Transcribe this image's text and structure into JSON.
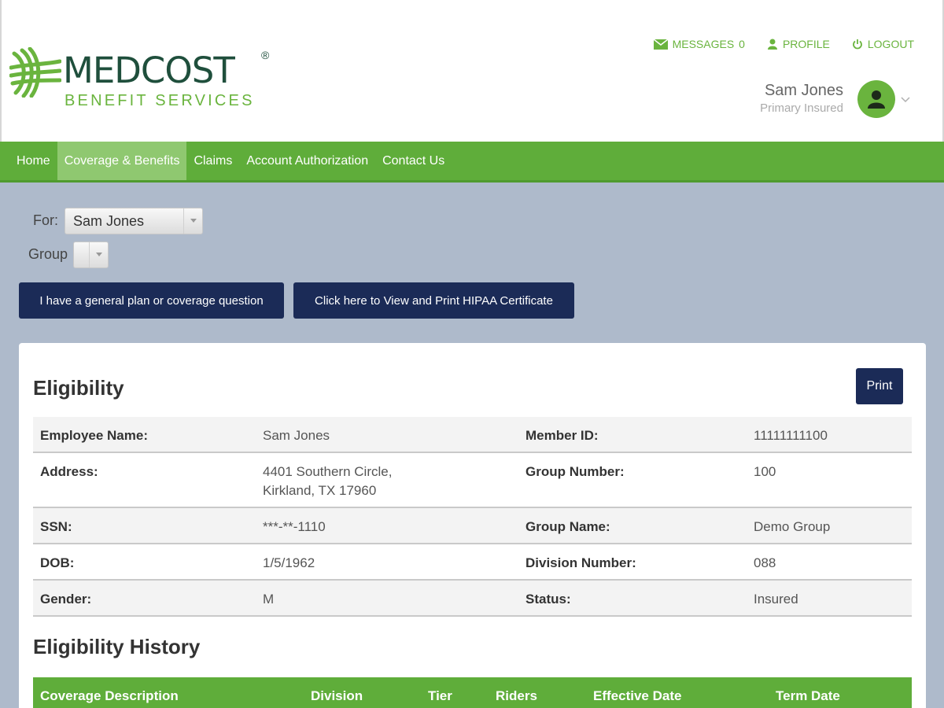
{
  "brand": {
    "name": "MEDCOST",
    "registered": "®",
    "subtitle": "BENEFIT SERVICES",
    "colors": {
      "green": "#6ab43e",
      "dark_green": "#1f4f3c",
      "navy": "#1b2b57",
      "nav_bg": "#5fad3a"
    }
  },
  "toplinks": {
    "messages_label": "MESSAGES",
    "messages_count": "0",
    "profile_label": "PROFILE",
    "logout_label": "LOGOUT",
    "icons": [
      "envelope-icon",
      "person-icon",
      "power-icon"
    ]
  },
  "user": {
    "name": "Sam Jones",
    "role": "Primary Insured"
  },
  "nav": {
    "items": [
      "Home",
      "Coverage & Benefits",
      "Claims",
      "Account Authorization",
      "Contact Us"
    ],
    "active": "Coverage & Benefits"
  },
  "filters": {
    "for_label": "For:",
    "for_value": "Sam Jones",
    "group_label": "Group",
    "group_value": ""
  },
  "actions": {
    "question_button": "I have a general plan or coverage question",
    "hipaa_button": "Click here to View and Print HIPAA Certificate"
  },
  "eligibility": {
    "title": "Eligibility",
    "print_label": "Print",
    "rows": [
      {
        "label1": "Employee Name:",
        "value1": "Sam Jones",
        "label2": "Member ID:",
        "value2": "11111111100"
      },
      {
        "label1": "Address:",
        "value1": "4401 Southern Circle,",
        "value1b": "Kirkland, TX 17960",
        "label2": "Group Number:",
        "value2": "100"
      },
      {
        "label1": "SSN:",
        "value1": "***-**-1110",
        "label2": "Group Name:",
        "value2": "Demo Group"
      },
      {
        "label1": "DOB:",
        "value1": "1/5/1962",
        "label2": "Division Number:",
        "value2": "088"
      },
      {
        "label1": "Gender:",
        "value1": "M",
        "label2": "Status:",
        "value2": "Insured"
      }
    ]
  },
  "history": {
    "title": "Eligibility History",
    "columns": [
      "Coverage Description",
      "Division",
      "Tier",
      "Riders",
      "Effective Date",
      "Term Date"
    ]
  }
}
